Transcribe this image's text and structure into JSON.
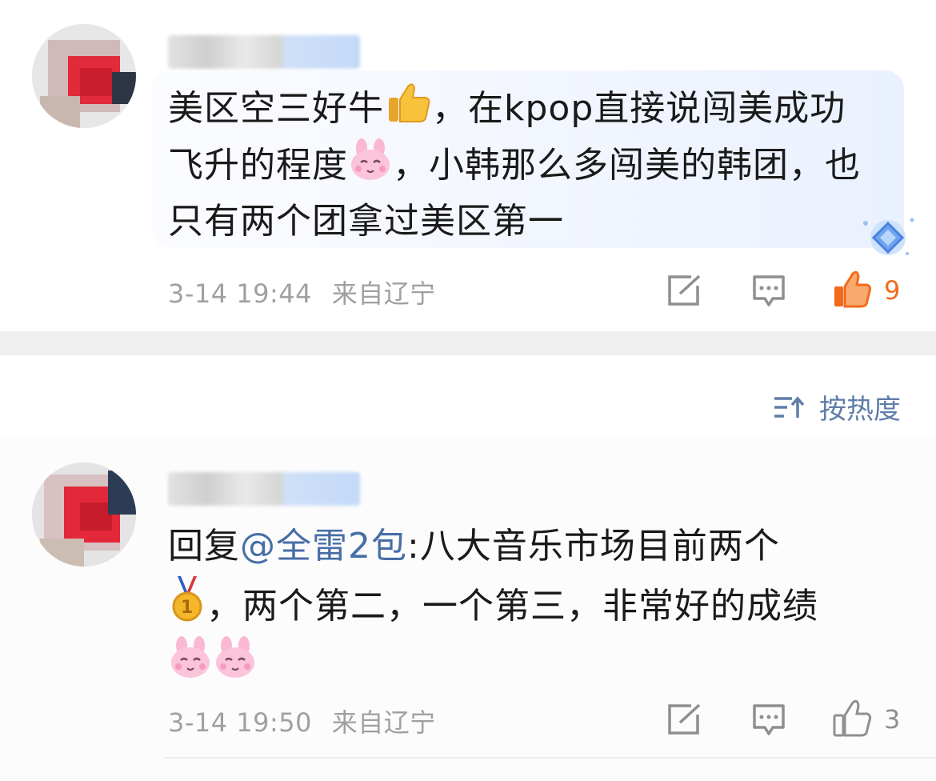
{
  "comments": [
    {
      "text_parts": [
        "美区空三好牛",
        "，在kpop直接说闯美成功飞升的程度",
        "，小韩那么多闯美的韩团，也只有两个团拿过美区第一"
      ],
      "time": "3-14 19:44",
      "location": "来自辽宁",
      "like_count": "9",
      "liked": true
    },
    {
      "reply_prefix": "回复",
      "mention": "@全雷2包",
      "text_parts": [
        ":八大音乐市场目前两个",
        "，两个第二，一个第三，非常好的成绩"
      ],
      "time": "3-14 19:50",
      "location": "来自辽宁",
      "like_count": "3",
      "liked": false
    }
  ],
  "sort": {
    "label": "按热度"
  },
  "icons": {
    "thumbs_up_emoji": "thumbs-up-emoji",
    "bunny_emoji": "bunny-emoji",
    "gold_medal_emoji": "gold-medal-emoji",
    "share": "share-icon",
    "comment": "comment-icon",
    "like": "like-icon",
    "sort": "sort-icon",
    "badge": "diamond-badge-icon"
  },
  "colors": {
    "liked": "#f26b1d",
    "mention": "#476ea6",
    "meta": "#a0a0a0"
  }
}
